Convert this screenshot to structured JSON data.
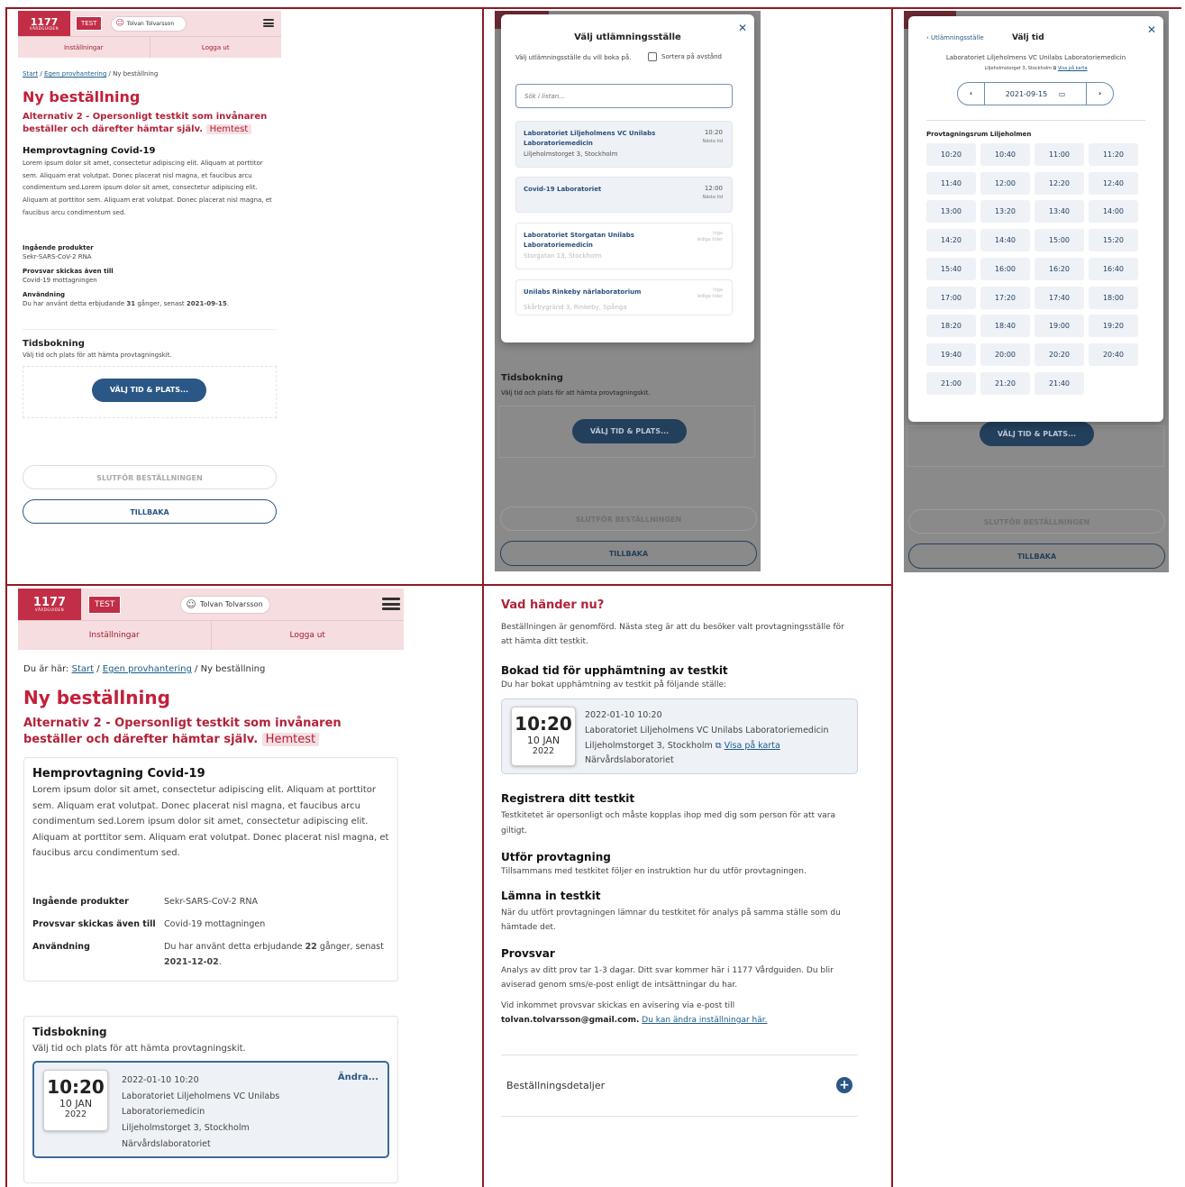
{
  "header": {
    "logo": "1177",
    "logo_sub": "VÅRDGUIDEN",
    "test": "TEST",
    "user": "Tolvan Tolvarsson",
    "nav_settings": "Inställningar",
    "nav_logout": "Logga ut"
  },
  "breadcrumb": {
    "here": "Du är här:",
    "start": "Start",
    "sep": "/",
    "egen": "Egen provhantering",
    "current": "Ny beställning"
  },
  "order": {
    "title": "Ny beställning",
    "alt_title": "Alternativ 2 - Opersonligt testkit som invånaren beställer och därefter hämtar själv.",
    "tag": "Hemtest",
    "home_title": "Hemprovtagning Covid-19",
    "lorem": "Lorem ipsum dolor sit amet, consectetur adipiscing elit. Aliquam at porttitor sem. Aliquam erat volutpat. Donec placerat nisl magna, et faucibus arcu condimentum sed.Lorem ipsum dolor sit amet, consectetur adipiscing elit. Aliquam at porttitor sem. Aliquam erat volutpat. Donec placerat nisl magna, et faucibus arcu condimentum sed.",
    "products_label": "Ingående produkter",
    "products": "Sekr-SARS-CoV-2 RNA",
    "send_label": "Provsvar skickas även till",
    "send": "Covid-19 mottagningen",
    "usage_label": "Användning",
    "usage_pre": "Du har använt detta erbjudande",
    "usage_post1": "gånger, senast",
    "count1": "31",
    "date1": "2021-09-15",
    "count2": "22",
    "date2": "2021-12-02",
    "booking_title": "Tidsbokning",
    "booking_desc": "Välj tid och plats för att hämta provtagningskit.",
    "choose_btn": "VÄLJ TID & PLATS...",
    "finish_btn": "SLUTFÖR BESTÄLLNINGEN",
    "back_btn": "TILLBAKA",
    "change": "Ändra...",
    "booked_time": "10:20",
    "booked_day": "10 JAN",
    "booked_year": "2022",
    "booked_dt": "2022-01-10 10:20",
    "booked_lab": "Laboratoriet Liljeholmens VC Unilabs Laboratoriemedicin",
    "booked_addr": "Liljeholmstorget 3, Stockholm",
    "booked_type": "Närvårdslaboratoriet"
  },
  "place_modal": {
    "title": "Välj utlämningsställe",
    "desc": "Välj utlämningsställe du vill boka på.",
    "sort": "Sortera på avstånd",
    "search_placeholder": "Sök i listan...",
    "labs": [
      {
        "name": "Laboratoriet Liljeholmens VC Unilabs Laboratoriemedicin",
        "addr": "Liljeholmstorget 3, Stockholm",
        "time": "10:20",
        "sub": "Nästa tid"
      },
      {
        "name": "Covid-19 Laboratoriet",
        "addr": "",
        "time": "12:00",
        "sub": "Nästa tid"
      },
      {
        "name": "Laboratoriet Storgatan Unilabs Laboratoriemedicin",
        "addr": "Storgatan 13, Stockholm",
        "time": "Inga",
        "sub": "lediga tider"
      },
      {
        "name": "Unilabs Rinkeby närlaboratorium",
        "addr": "Skårbygränd 3, Rinkeby, Spånga",
        "time": "Inga",
        "sub": "lediga tider"
      }
    ]
  },
  "time_modal": {
    "back": "Utlämningsställe",
    "title": "Välj tid",
    "lab": "Laboratoriet Liljeholmens VC Unilabs Laboratoriemedicin",
    "addr": "Liljeholmstorget 3, Stockholm",
    "map": "Visa på karta",
    "date": "2021-09-15",
    "room": "Provtagningsrum Liljeholmen",
    "slots": [
      "10:20",
      "10:40",
      "11:00",
      "11:20",
      "11:40",
      "12:00",
      "12:20",
      "12:40",
      "13:00",
      "13:20",
      "13:40",
      "14:00",
      "14:20",
      "14:40",
      "15:00",
      "15:20",
      "15:40",
      "16:00",
      "16:20",
      "16:40",
      "17:00",
      "17:20",
      "17:40",
      "18:00",
      "18:20",
      "18:40",
      "19:00",
      "19:20",
      "19:40",
      "20:00",
      "20:20",
      "20:40",
      "21:00",
      "21:20",
      "21:40"
    ]
  },
  "confirm": {
    "title": "Vad händer nu?",
    "intro": "Beställningen är genomförd. Nästa steg är att du besöker valt provtagningsställe för att hämta ditt testkit.",
    "booked_title": "Bokad tid för upphämtning av testkit",
    "booked_desc": "Du har bokat upphämtning av testkit på följande ställe:",
    "map": "Visa på karta",
    "reg_title": "Registrera ditt testkit",
    "reg_desc": "Testkitetet är opersonligt och måste kopplas ihop med dig som person för att vara giltigt.",
    "do_title": "Utför provtagning",
    "do_desc": "Tillsammans med testkitet följer en instruktion hur du utför provtagningen.",
    "leave_title": "Lämna in testkit",
    "leave_desc": "När du utfört provtagningen lämnar du testkitet för analys på samma ställe som du hämtade det.",
    "answer_title": "Provsvar",
    "answer_desc": "Analys av ditt prov tar 1-3 dagar. Ditt svar kommer här i 1177 Vårdguiden. Du blir aviserad genom sms/e-post enligt de intsättningar du har.",
    "notice": "Vid inkommet provsvar skickas en avisering via e-post till",
    "email": "tolvan.tolvarsson@gmail.com.",
    "change_link": "Du kan ändra inställningar här.",
    "details": "Beställningsdetaljer"
  }
}
